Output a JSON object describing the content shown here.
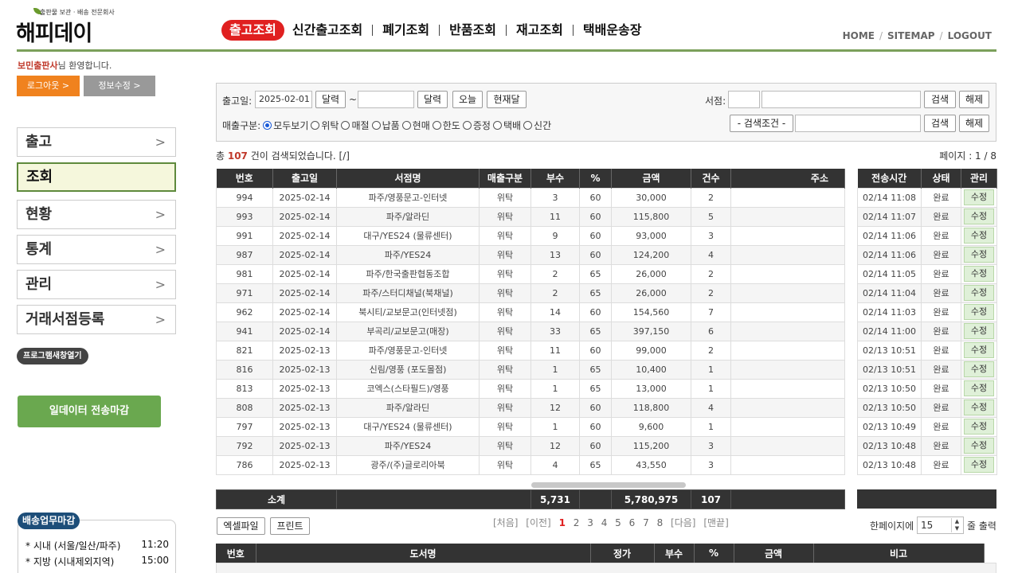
{
  "header": {
    "tagline": "출판물 보관 · 배송 전문회사",
    "logo": "해피데이",
    "nav": [
      "출고조회",
      "신간출고조회",
      "폐기조회",
      "반품조회",
      "재고조회",
      "택배운송장"
    ],
    "top_menu": [
      "HOME",
      "SITEMAP",
      "LOGOUT"
    ]
  },
  "user": {
    "name": "보민출판사",
    "suffix": "님 환영합니다."
  },
  "buttons": {
    "logout": "로그아웃 >",
    "info_edit": "정보수정 >"
  },
  "left_menu": [
    "출고",
    "조회",
    "현황",
    "통계",
    "관리",
    "거래서점등록"
  ],
  "popup_btn": "프로그램새창열기",
  "close_btn": "일데이터 전송마감",
  "shipping": {
    "title": "배송업무마감",
    "rows": [
      {
        "region": "* 시내 (서울/일산/파주)",
        "time": "11:20"
      },
      {
        "region": "* 지방 (시내제외지역)",
        "time": "15:00"
      }
    ]
  },
  "search": {
    "date_label": "출고일:",
    "date_from": "2025-02-01",
    "tilde": "~",
    "date_to": "",
    "calendar_btn": "달력",
    "today_btn": "오늘",
    "month_btn": "현재달",
    "store_label": "서점:",
    "search_btn": "검색",
    "reset_btn": "해제",
    "sale_label": "매출구분:",
    "sale_options": [
      "모두보기",
      "위탁",
      "매절",
      "납품",
      "현매",
      "한도",
      "증정",
      "택배",
      "신간"
    ],
    "condition_select": "- 검색조건 -"
  },
  "result": {
    "prefix": "총 ",
    "count": "107",
    "suffix": " 건이 검색되었습니다. [/]",
    "page": "페이지 : 1 / 8"
  },
  "grid": {
    "headers": [
      "번호",
      "출고일",
      "서점명",
      "매출구분",
      "부수",
      "%",
      "금액",
      "건수",
      "주소"
    ],
    "side_headers": [
      "전송시간",
      "상태",
      "관리"
    ],
    "rows": [
      [
        "994",
        "2025-02-14",
        "파주/영풍문고-인터넷",
        "위탁",
        "3",
        "60",
        "30,000",
        "2",
        "",
        "02/14 11:08",
        "완료",
        "수정"
      ],
      [
        "993",
        "2025-02-14",
        "파주/알라딘",
        "위탁",
        "11",
        "60",
        "115,800",
        "5",
        "",
        "02/14 11:07",
        "완료",
        "수정"
      ],
      [
        "991",
        "2025-02-14",
        "대구/YES24 (물류센터)",
        "위탁",
        "9",
        "60",
        "93,000",
        "3",
        "",
        "02/14 11:06",
        "완료",
        "수정"
      ],
      [
        "987",
        "2025-02-14",
        "파주/YES24",
        "위탁",
        "13",
        "60",
        "124,200",
        "4",
        "",
        "02/14 11:06",
        "완료",
        "수정"
      ],
      [
        "981",
        "2025-02-14",
        "파주/한국출판협동조합",
        "위탁",
        "2",
        "65",
        "26,000",
        "2",
        "",
        "02/14 11:05",
        "완료",
        "수정"
      ],
      [
        "971",
        "2025-02-14",
        "파주/스터디채널(북채널)",
        "위탁",
        "2",
        "65",
        "26,000",
        "2",
        "",
        "02/14 11:04",
        "완료",
        "수정"
      ],
      [
        "962",
        "2025-02-14",
        "북시티/교보문고(인터넷점)",
        "위탁",
        "14",
        "60",
        "154,560",
        "7",
        "",
        "02/14 11:03",
        "완료",
        "수정"
      ],
      [
        "941",
        "2025-02-14",
        "부곡리/교보문고(매장)",
        "위탁",
        "33",
        "65",
        "397,150",
        "6",
        "",
        "02/14 11:00",
        "완료",
        "수정"
      ],
      [
        "821",
        "2025-02-13",
        "파주/영풍문고-인터넷",
        "위탁",
        "11",
        "60",
        "99,000",
        "2",
        "",
        "02/13 10:51",
        "완료",
        "수정"
      ],
      [
        "816",
        "2025-02-13",
        "신림/영풍 (포도몰점)",
        "위탁",
        "1",
        "65",
        "10,400",
        "1",
        "",
        "02/13 10:51",
        "완료",
        "수정"
      ],
      [
        "813",
        "2025-02-13",
        "코엑스(스타필드)/영풍",
        "위탁",
        "1",
        "65",
        "13,000",
        "1",
        "",
        "02/13 10:50",
        "완료",
        "수정"
      ],
      [
        "808",
        "2025-02-13",
        "파주/알라딘",
        "위탁",
        "12",
        "60",
        "118,800",
        "4",
        "",
        "02/13 10:50",
        "완료",
        "수정"
      ],
      [
        "797",
        "2025-02-13",
        "대구/YES24 (물류센터)",
        "위탁",
        "1",
        "60",
        "9,600",
        "1",
        "",
        "02/13 10:49",
        "완료",
        "수정"
      ],
      [
        "792",
        "2025-02-13",
        "파주/YES24",
        "위탁",
        "12",
        "60",
        "115,200",
        "3",
        "",
        "02/13 10:48",
        "완료",
        "수정"
      ],
      [
        "786",
        "2025-02-13",
        "광주/(주)글로리아북",
        "위탁",
        "4",
        "65",
        "43,550",
        "3",
        "",
        "02/13 10:48",
        "완료",
        "수정"
      ]
    ],
    "summary": {
      "label": "소계",
      "qty": "5,731",
      "amount": "5,780,975",
      "count": "107"
    }
  },
  "footer": {
    "excel_btn": "엑셀파일",
    "print_btn": "프린트",
    "pager_first": "[처음]",
    "pager_prev": "[이전]",
    "pages": [
      "1",
      "2",
      "3",
      "4",
      "5",
      "6",
      "7",
      "8"
    ],
    "pager_next": "[다음]",
    "pager_last": "[맨끝]",
    "perpage_label": "한페이지에",
    "perpage_value": "15",
    "perpage_suffix": "줄 출력"
  },
  "book_grid": {
    "headers": [
      "번호",
      "도서명",
      "정가",
      "부수",
      "%",
      "금액",
      "비고"
    ]
  },
  "colors": {
    "accent_red": "#e02020",
    "green": "#6aa84f",
    "header_dark": "#333333",
    "orange": "#f0821e"
  }
}
